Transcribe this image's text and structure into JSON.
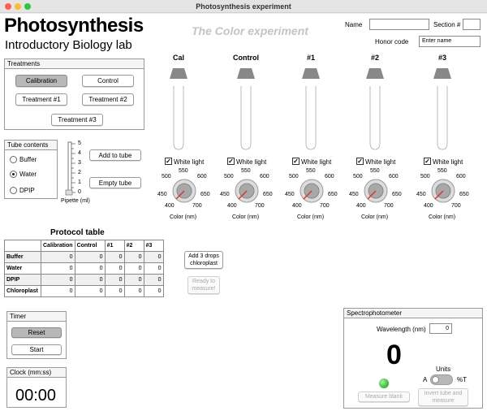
{
  "window": {
    "title": "Photosynthesis experiment"
  },
  "header": {
    "title": "Photosynthesis",
    "subtitle": "Introductory Biology lab",
    "tagline": "The Color experiment"
  },
  "student": {
    "name_label": "Name",
    "name_value": "",
    "section_label": "Section #",
    "section_value": "",
    "honor_label": "Honor code",
    "honor_placeholder": "Enter name"
  },
  "treatments": {
    "title": "Treatments",
    "buttons": [
      "Calibration",
      "Control",
      "Treatment #1",
      "Treatment #2",
      "Treatment #3"
    ],
    "selected": "Calibration"
  },
  "tube_contents": {
    "title": "Tube contents",
    "options": [
      "Buffer",
      "Water",
      "DPIP"
    ],
    "selected": "Water"
  },
  "pipette": {
    "label": "Pipette (ml)",
    "scale": [
      "5",
      "4",
      "3",
      "2",
      "1",
      "0"
    ],
    "level": 0
  },
  "actions": {
    "add": "Add to tube",
    "empty": "Empty tube"
  },
  "tubes": [
    {
      "label": "Cal",
      "white_light": "White light",
      "light_on": true,
      "color_label": "Color (nm)"
    },
    {
      "label": "Control",
      "white_light": "White light",
      "light_on": true,
      "color_label": "Color (nm)"
    },
    {
      "label": "#1",
      "white_light": "White light",
      "light_on": true,
      "color_label": "Color (nm)"
    },
    {
      "label": "#2",
      "white_light": "White light",
      "light_on": true,
      "color_label": "Color (nm)"
    },
    {
      "label": "#3",
      "white_light": "White light",
      "light_on": true,
      "color_label": "Color (nm)"
    }
  ],
  "dial_ticks": {
    "t400": "400",
    "t450": "450",
    "t500": "500",
    "t550": "550",
    "t600": "600",
    "t650": "650",
    "t700": "700"
  },
  "protocol": {
    "title": "Protocol table",
    "columns": [
      "",
      "Calibration",
      "Control",
      "#1",
      "#2",
      "#3"
    ],
    "rows": [
      {
        "label": "Buffer",
        "values": [
          "0",
          "0",
          "0",
          "0",
          "0"
        ]
      },
      {
        "label": "Water",
        "values": [
          "0",
          "0",
          "0",
          "0",
          "0"
        ]
      },
      {
        "label": "DPIP",
        "values": [
          "0",
          "0",
          "0",
          "0",
          "0"
        ]
      },
      {
        "label": "Chloroplast",
        "values": [
          "0",
          "0",
          "0",
          "0",
          "0"
        ]
      }
    ],
    "add_chloroplast": "Add 3 drops chloroplast",
    "ready": "Ready to measure!"
  },
  "timer": {
    "title": "Timer",
    "reset": "Reset",
    "start": "Start"
  },
  "clock": {
    "title": "Clock (mm:ss)",
    "value": "00:00"
  },
  "spectro": {
    "title": "Spectrophotometer",
    "wavelength_label": "Wavelength (nm)",
    "wavelength_value": "0",
    "reading": "0",
    "units_label": "Units",
    "unit_a": "A",
    "unit_t": "%T",
    "measure_blank": "Measure blank",
    "invert": "Invert tube and measure"
  },
  "colors": {
    "accent": "#e03030",
    "led": "#39c43c",
    "selected": "#b8b8b8"
  }
}
